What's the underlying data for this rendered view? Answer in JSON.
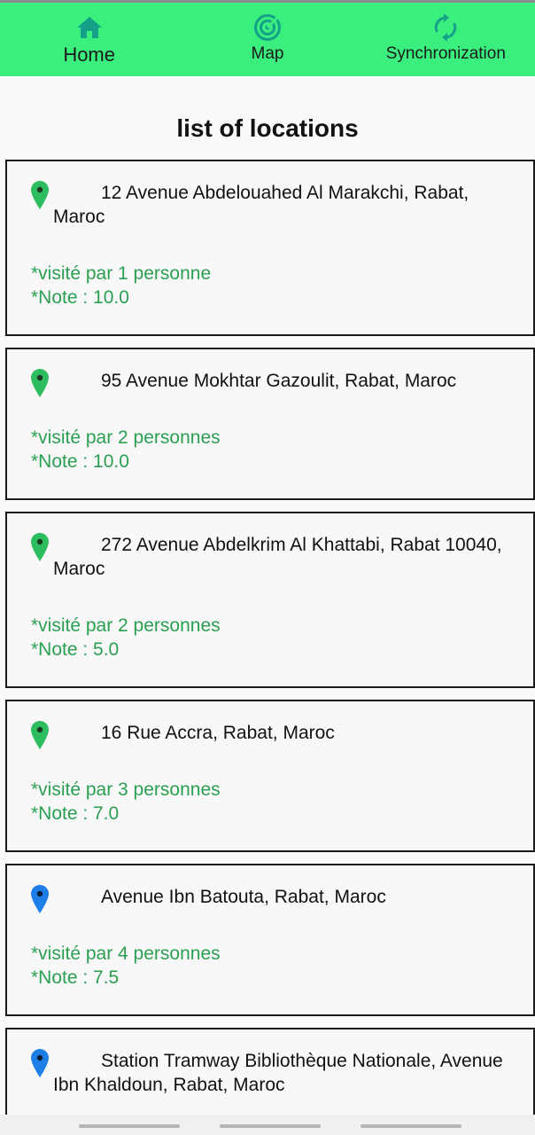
{
  "tabs": [
    {
      "label": "Home",
      "icon": "home-icon",
      "active": true
    },
    {
      "label": "Map",
      "icon": "radar-icon",
      "active": false
    },
    {
      "label": "Synchronization",
      "icon": "sync-icon",
      "active": false
    }
  ],
  "page": {
    "title": "list of locations"
  },
  "locations": [
    {
      "address": "12 Avenue Abdelouahed Al Marakchi, Rabat, Maroc",
      "visits": "*visité par 1  personne",
      "note": "*Note : 10.0",
      "pin_color": "#2ebd5e"
    },
    {
      "address": "95 Avenue Mokhtar Gazoulit, Rabat, Maroc",
      "visits": "*visité par 2  personnes",
      "note": "*Note : 10.0",
      "pin_color": "#2ebd5e"
    },
    {
      "address": "272 Avenue Abdelkrim Al Khattabi, Rabat 10040, Maroc",
      "visits": "*visité par 2  personnes",
      "note": "*Note : 5.0",
      "pin_color": "#2ebd5e"
    },
    {
      "address": "16 Rue Accra, Rabat, Maroc",
      "visits": "*visité par 3  personnes",
      "note": "*Note : 7.0",
      "pin_color": "#2ebd5e"
    },
    {
      "address": "Avenue Ibn Batouta, Rabat, Maroc",
      "visits": "*visité par 4  personnes",
      "note": "*Note : 7.5",
      "pin_color": "#1e7ee8"
    },
    {
      "address": "Station Tramway Bibliothèque Nationale, Avenue Ibn Khaldoun, Rabat, Maroc",
      "visits": "",
      "note": "",
      "pin_color": "#1e7ee8"
    }
  ],
  "colors": {
    "tabbar": "#3bef7f",
    "icon": "#15a08a",
    "stats_text": "#2a9f52"
  }
}
